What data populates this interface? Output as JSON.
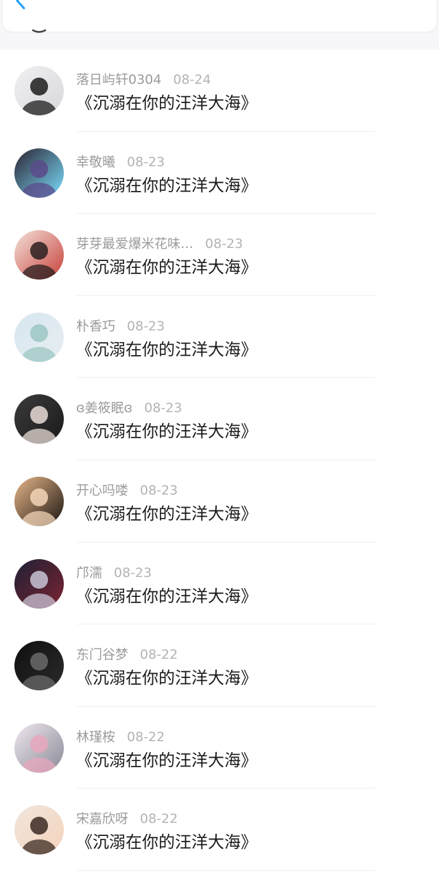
{
  "header": {
    "back_icon": "chevron-left-icon",
    "accent_color": "#1e9ffa"
  },
  "list": {
    "items": [
      {
        "name": "落日屿轩0304",
        "date": "08-24",
        "title": "《沉溺在你的汪洋大海》",
        "avatar_colors": [
          "#f0f0f2",
          "#1c1c1c",
          "#d8d8dc"
        ]
      },
      {
        "name": "幸敬曦",
        "date": "08-23",
        "title": "《沉溺在你的汪洋大海》",
        "avatar_colors": [
          "#2c2230",
          "#5b4a8a",
          "#7adfff"
        ]
      },
      {
        "name": "芽芽最爱爆米花味…",
        "date": "08-23",
        "title": "《沉溺在你的汪洋大海》",
        "avatar_colors": [
          "#f3e1d9",
          "#2a1f1f",
          "#c7413b"
        ]
      },
      {
        "name": "朴香巧",
        "date": "08-23",
        "title": "《沉溺在你的汪洋大海》",
        "avatar_colors": [
          "#d6e6ee",
          "#9cc7c2",
          "#e8eef2"
        ]
      },
      {
        "name": "ɞ姜筱眠ɞ",
        "date": "08-23",
        "title": "《沉溺在你的汪洋大海》",
        "avatar_colors": [
          "#3a3a3a",
          "#e9dcd6",
          "#1b1b1b"
        ]
      },
      {
        "name": "开心吗喽",
        "date": "08-23",
        "title": "《沉溺在你的汪洋大海》",
        "avatar_colors": [
          "#e9b78a",
          "#f3d6b8",
          "#1a1512"
        ]
      },
      {
        "name": "邝濡",
        "date": "08-23",
        "title": "《沉溺在你的汪洋大海》",
        "avatar_colors": [
          "#1f2035",
          "#c8c4d6",
          "#7a2430"
        ]
      },
      {
        "name": "东门谷梦",
        "date": "08-22",
        "title": "《沉溺在你的汪洋大海》",
        "avatar_colors": [
          "#0f0f0f",
          "#6a6a6a",
          "#2b2b2b"
        ]
      },
      {
        "name": "林瑾桉",
        "date": "08-22",
        "title": "《沉溺在你的汪洋大海》",
        "avatar_colors": [
          "#efe7ef",
          "#e8a7bd",
          "#8a8a96"
        ]
      },
      {
        "name": "宋嘉欣呀",
        "date": "08-22",
        "title": "《沉溺在你的汪洋大海》",
        "avatar_colors": [
          "#f1e6dd",
          "#3b2a22",
          "#f4d3bc"
        ]
      }
    ]
  }
}
